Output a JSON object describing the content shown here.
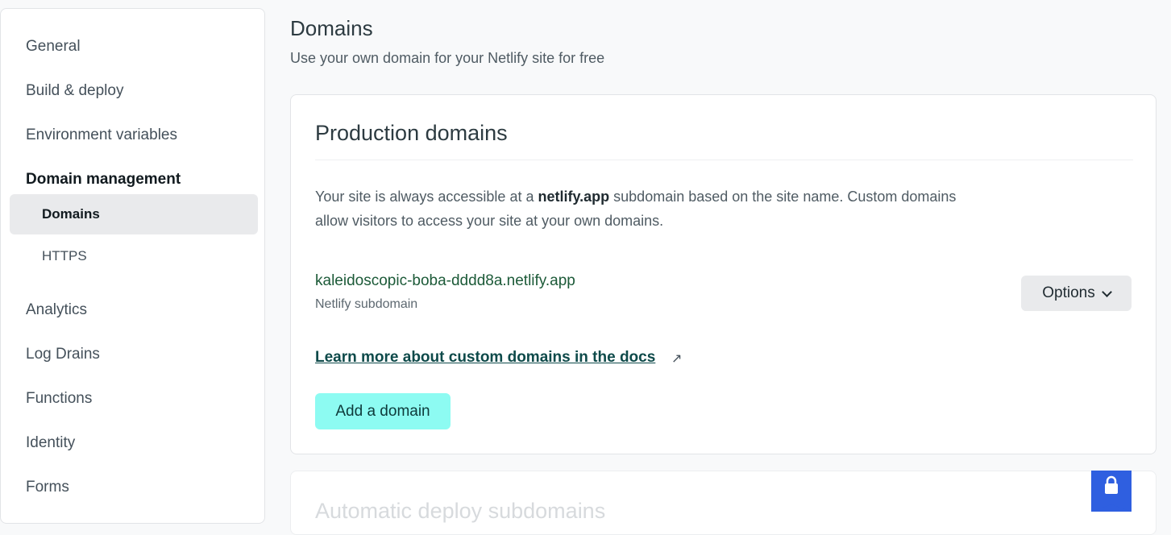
{
  "sidebar": {
    "items": [
      {
        "label": "General"
      },
      {
        "label": "Build & deploy"
      },
      {
        "label": "Environment variables"
      },
      {
        "label": "Domain management"
      },
      {
        "label": "Domains"
      },
      {
        "label": "HTTPS"
      },
      {
        "label": "Analytics"
      },
      {
        "label": "Log Drains"
      },
      {
        "label": "Functions"
      },
      {
        "label": "Identity"
      },
      {
        "label": "Forms"
      }
    ],
    "active_section": "Domain management",
    "selected_item": "Domains"
  },
  "header": {
    "title": "Domains",
    "subtitle": "Use your own domain for your Netlify site for free"
  },
  "production": {
    "title": "Production domains",
    "desc_pre": "Your site is always accessible at a ",
    "desc_bold": "netlify.app",
    "desc_post": " subdomain based on the site name. Custom domains allow visitors to access your site at your own domains.",
    "domain_name": "kaleidoscopic-boba-dddd8a.netlify.app",
    "domain_type": "Netlify subdomain",
    "options_label": "Options",
    "docs_link": "Learn more about custom domains in the docs",
    "external_icon": "↗",
    "add_button": "Add a domain"
  },
  "automatic": {
    "title": "Automatic deploy subdomains"
  },
  "colors": {
    "accent_button": "#8dfbf2",
    "link": "#0e4a4a",
    "domain_text": "#1c5a38",
    "badge": "#2f5fe0"
  }
}
